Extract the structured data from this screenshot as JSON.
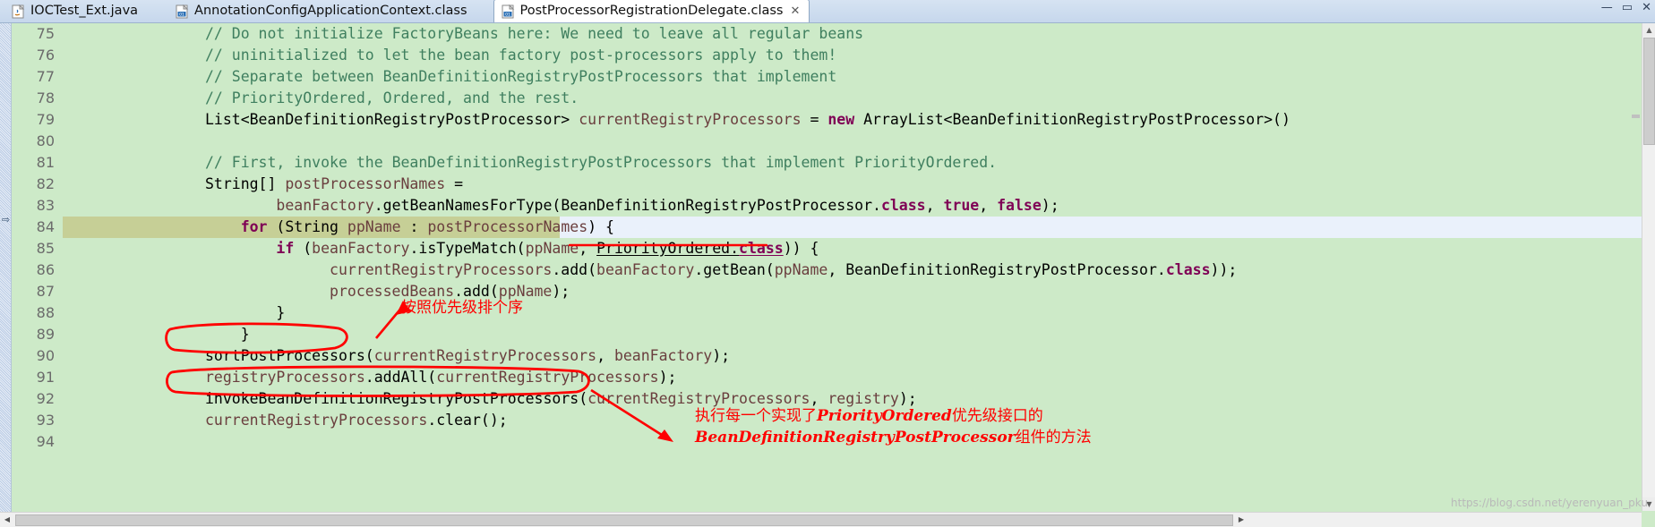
{
  "window": {
    "controls": [
      "minimize",
      "maximize",
      "close"
    ],
    "minimize_glyph": "—",
    "maximize_glyph": "▭",
    "close_glyph": "✕"
  },
  "tabs": [
    {
      "label": "IOCTest_Ext.java",
      "icon": "java-file-icon",
      "active": false,
      "closable": false
    },
    {
      "label": "AnnotationConfigApplicationContext.class",
      "icon": "class-file-icon",
      "active": false,
      "closable": false
    },
    {
      "label": "PostProcessorRegistrationDelegate.class",
      "icon": "class-file-icon",
      "active": true,
      "closable": true,
      "close_glyph": "✕"
    }
  ],
  "editor": {
    "first_line": 75,
    "lines": [
      {
        "n": 75,
        "indent": 8,
        "tokens": [
          {
            "t": "// Do not initialize FactoryBeans here: We need to leave all regular beans",
            "c": "cmt"
          }
        ]
      },
      {
        "n": 76,
        "indent": 8,
        "tokens": [
          {
            "t": "// uninitialized to let the bean factory post-processors apply to them!",
            "c": "cmt"
          }
        ]
      },
      {
        "n": 77,
        "indent": 8,
        "tokens": [
          {
            "t": "// Separate between BeanDefinitionRegistryPostProcessors that implement",
            "c": "cmt"
          }
        ]
      },
      {
        "n": 78,
        "indent": 8,
        "tokens": [
          {
            "t": "// PriorityOrdered, Ordered, and the rest.",
            "c": "cmt"
          }
        ]
      },
      {
        "n": 79,
        "indent": 8,
        "tokens": [
          {
            "t": "List<BeanDefinitionRegistryPostProcessor> ",
            "c": "plain"
          },
          {
            "t": "currentRegistryProcessors",
            "c": "lvar"
          },
          {
            "t": " = ",
            "c": "plain"
          },
          {
            "t": "new",
            "c": "kw"
          },
          {
            "t": " ArrayList<BeanDefinitionRegistryPostProcessor>()",
            "c": "plain"
          }
        ]
      },
      {
        "n": 80,
        "indent": 0,
        "tokens": []
      },
      {
        "n": 81,
        "indent": 8,
        "tokens": [
          {
            "t": "// First, invoke the BeanDefinitionRegistryPostProcessors that implement PriorityOrdered.",
            "c": "cmt"
          }
        ]
      },
      {
        "n": 82,
        "indent": 8,
        "tokens": [
          {
            "t": "String[] ",
            "c": "plain"
          },
          {
            "t": "postProcessorNames",
            "c": "lvar"
          },
          {
            "t": " =",
            "c": "plain"
          }
        ]
      },
      {
        "n": 83,
        "indent": 12,
        "tokens": [
          {
            "t": "beanFactory",
            "c": "lvar"
          },
          {
            "t": ".getBeanNamesForType(BeanDefinitionRegistryPostProcessor.",
            "c": "plain"
          },
          {
            "t": "class",
            "c": "kw"
          },
          {
            "t": ", ",
            "c": "plain"
          },
          {
            "t": "true",
            "c": "kw"
          },
          {
            "t": ", ",
            "c": "plain"
          },
          {
            "t": "false",
            "c": "kw"
          },
          {
            "t": ");",
            "c": "plain"
          }
        ]
      },
      {
        "n": 84,
        "indent": 10,
        "current": true,
        "tokens": [
          {
            "t": "for",
            "c": "kw"
          },
          {
            "t": " (String ",
            "c": "plain"
          },
          {
            "t": "ppName",
            "c": "lvar"
          },
          {
            "t": " : ",
            "c": "plain"
          },
          {
            "t": "postProcessorNames",
            "c": "lvar"
          },
          {
            "t": ") {",
            "c": "plain"
          }
        ]
      },
      {
        "n": 85,
        "indent": 12,
        "tokens": [
          {
            "t": "if",
            "c": "kw"
          },
          {
            "t": " (",
            "c": "plain"
          },
          {
            "t": "beanFactory",
            "c": "lvar"
          },
          {
            "t": ".isTypeMatch(",
            "c": "plain"
          },
          {
            "t": "ppName",
            "c": "lvar"
          },
          {
            "t": ", ",
            "c": "plain"
          },
          {
            "t": "PriorityOrdered.",
            "c": "plain",
            "u": true
          },
          {
            "t": "class",
            "c": "kw",
            "u": true
          },
          {
            "t": ")) {",
            "c": "plain"
          }
        ]
      },
      {
        "n": 86,
        "indent": 15,
        "tokens": [
          {
            "t": "currentRegistryProcessors",
            "c": "lvar"
          },
          {
            "t": ".add(",
            "c": "plain"
          },
          {
            "t": "beanFactory",
            "c": "lvar"
          },
          {
            "t": ".getBean(",
            "c": "plain"
          },
          {
            "t": "ppName",
            "c": "lvar"
          },
          {
            "t": ", BeanDefinitionRegistryPostProcessor.",
            "c": "plain"
          },
          {
            "t": "class",
            "c": "kw"
          },
          {
            "t": "));",
            "c": "plain"
          }
        ]
      },
      {
        "n": 87,
        "indent": 15,
        "tokens": [
          {
            "t": "processedBeans",
            "c": "lvar"
          },
          {
            "t": ".add(",
            "c": "plain"
          },
          {
            "t": "ppName",
            "c": "lvar"
          },
          {
            "t": ");",
            "c": "plain"
          }
        ]
      },
      {
        "n": 88,
        "indent": 12,
        "tokens": [
          {
            "t": "}",
            "c": "plain"
          }
        ]
      },
      {
        "n": 89,
        "indent": 10,
        "tokens": [
          {
            "t": "}",
            "c": "plain"
          }
        ]
      },
      {
        "n": 90,
        "indent": 8,
        "tokens": [
          {
            "t": "sortPostProcessors",
            "c": "plain"
          },
          {
            "t": "(",
            "c": "plain"
          },
          {
            "t": "currentRegistryProcessors",
            "c": "lvar"
          },
          {
            "t": ", ",
            "c": "plain"
          },
          {
            "t": "beanFactory",
            "c": "lvar"
          },
          {
            "t": ");",
            "c": "plain"
          }
        ]
      },
      {
        "n": 91,
        "indent": 8,
        "tokens": [
          {
            "t": "registryProcessors",
            "c": "lvar"
          },
          {
            "t": ".addAll(",
            "c": "plain"
          },
          {
            "t": "currentRegistryProcessors",
            "c": "lvar"
          },
          {
            "t": ");",
            "c": "plain"
          }
        ]
      },
      {
        "n": 92,
        "indent": 8,
        "tokens": [
          {
            "t": "invokeBeanDefinitionRegistryPostProcessors",
            "c": "plain"
          },
          {
            "t": "(",
            "c": "plain"
          },
          {
            "t": "currentRegistryProcessors",
            "c": "lvar"
          },
          {
            "t": ", ",
            "c": "plain"
          },
          {
            "t": "registry",
            "c": "lvar"
          },
          {
            "t": ");",
            "c": "plain"
          }
        ]
      },
      {
        "n": 93,
        "indent": 8,
        "tokens": [
          {
            "t": "currentRegistryProcessors",
            "c": "lvar"
          },
          {
            "t": ".clear();",
            "c": "plain"
          }
        ]
      },
      {
        "n": 94,
        "indent": 0,
        "tokens": []
      }
    ]
  },
  "annotations": {
    "color": "#ff0000",
    "note_1": "按照优先级排个序",
    "note_2_line1_prefix": "执行每一个实现了",
    "note_2_line1_em": "PriorityOrdered",
    "note_2_line1_suffix": "优先级接口的",
    "note_2_line2_em": "BeanDefinitionRegistryPostProcessor",
    "note_2_line2_suffix": "组件的方法",
    "circled_1": "sortPostProcessors",
    "circled_2": "invokeBeanDefinitionRegistryPostProcessors"
  },
  "watermark": {
    "text": "https://blog.csdn.net/yerenyuan_pku"
  },
  "scrollbars": {
    "vertical_up_glyph": "▲",
    "vertical_down_glyph": "▼",
    "horizontal_left_glyph": "◀",
    "horizontal_right_glyph": "▶"
  },
  "colors": {
    "editor_background": "#cdeac8",
    "current_line_olive": "#c6cf96",
    "current_line_blue": "#eaf1fb",
    "comment": "#3f7f5f",
    "keyword": "#7f0055",
    "local_variable": "#6a3e3e",
    "annotation_red": "#ff0000",
    "tabbar": "#c6d7ec"
  }
}
